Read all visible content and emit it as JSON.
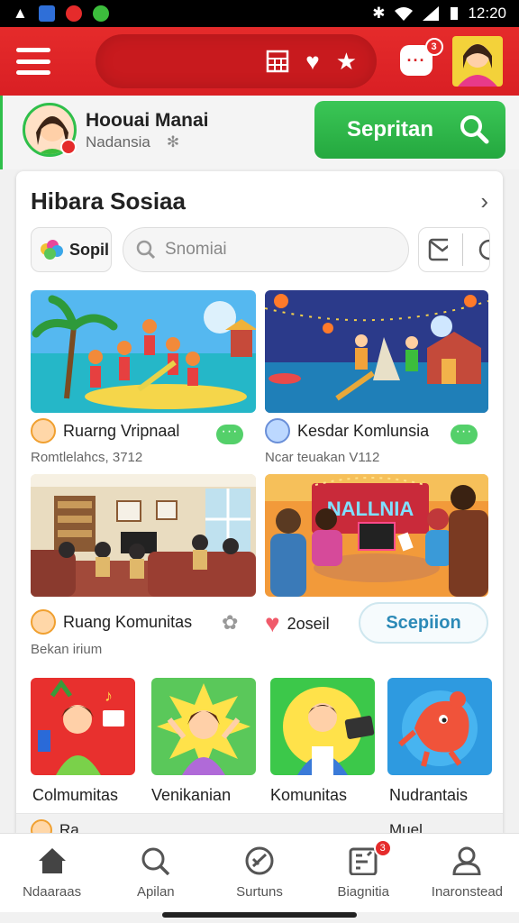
{
  "status": {
    "time": "12:20"
  },
  "appbar": {
    "notification_count": "3"
  },
  "profile": {
    "name": "Hoouai Manai",
    "subtitle": "Nadansia",
    "action_label": "Sepritan"
  },
  "section": {
    "title": "Hibara Sosiaa",
    "chip_label": "Sopil",
    "search_placeholder": "Snomiai"
  },
  "rooms": [
    {
      "title": "Ruarng Vripnaal",
      "subtitle": "Romtlelahcs, 3712"
    },
    {
      "title": "Kesdar Komlunsia",
      "subtitle": "Ncar teuakan V112"
    },
    {
      "title": "Ruang Komunitas",
      "subtitle": "Bekan irium"
    },
    {
      "title": "2oseil",
      "neon_sign": "NALLNIA"
    }
  ],
  "action_button": "Scepiion",
  "categories": [
    {
      "label": "Colmumitas"
    },
    {
      "label": "Venikanian"
    },
    {
      "label": "Komunitas"
    },
    {
      "label": "Nudrantais"
    }
  ],
  "peek": {
    "left": "Ra...",
    "right": "Muel..."
  },
  "nav": [
    {
      "label": "Ndaaraas",
      "icon": "home-icon"
    },
    {
      "label": "Apilan",
      "icon": "search-icon"
    },
    {
      "label": "Surtuns",
      "icon": "compass-icon"
    },
    {
      "label": "Biagnitia",
      "icon": "grid-icon",
      "badge": "3"
    },
    {
      "label": "Inaronstead",
      "icon": "person-icon"
    }
  ],
  "colors": {
    "brand_red": "#d91f24",
    "accent_green": "#2fbf4a",
    "link_blue": "#2c8ab7"
  }
}
